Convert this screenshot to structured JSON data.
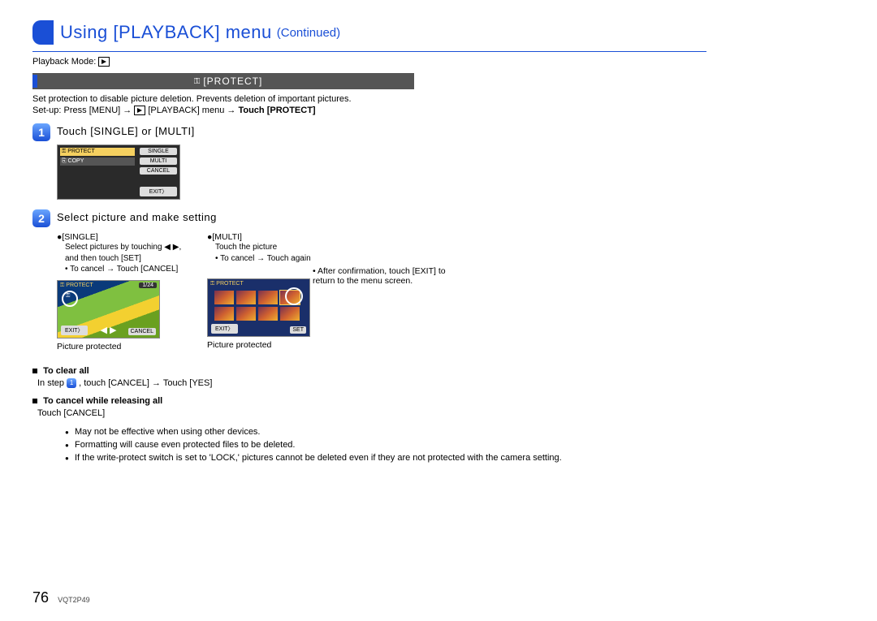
{
  "title": {
    "main": "Using [PLAYBACK] menu",
    "continued": "(Continued)"
  },
  "mode_line": {
    "label": "Playback Mode:"
  },
  "section_bar": {
    "key_glyph": "⚿",
    "text": "[PROTECT]"
  },
  "intro": "Set protection to disable picture deletion. Prevents deletion of important pictures.",
  "setup": {
    "prefix": "Set-up: Press [MENU] → ",
    "mid": " [PLAYBACK] menu → ",
    "suffix": "Touch [PROTECT]"
  },
  "step1": {
    "num": "1",
    "title": "Touch [SINGLE] or [MULTI]",
    "lcd": {
      "row_protect": "⚿ PROTECT",
      "row_copy": "⎘ COPY",
      "btn_single": "SINGLE",
      "btn_multi": "MULTI",
      "btn_cancel": "CANCEL",
      "btn_exit": "EXIT〉"
    }
  },
  "step2": {
    "num": "2",
    "title": "Select picture and make setting",
    "single": {
      "label": "●[SINGLE]",
      "line1": "Select pictures by touching ◀ ▶,",
      "line2": "and then touch [SET]",
      "line3": "• To cancel → Touch [CANCEL]",
      "lcd": {
        "top": "⚿ PROTECT",
        "idx": "1/24",
        "exit": "EXIT〉",
        "cancel": "CANCEL",
        "arrows": "◀  ▶"
      },
      "caption": "Picture protected"
    },
    "multi": {
      "label": "●[MULTI]",
      "line1": "Touch the picture",
      "line2": "• To cancel → Touch again",
      "lcd": {
        "top": "⚿ PROTECT",
        "exit": "EXIT〉",
        "set": "SET"
      },
      "caption": "Picture protected"
    },
    "side_note": "• After confirmation, touch [EXIT] to return to the menu screen."
  },
  "clear": {
    "heading": "To clear all",
    "text_pre": "In step ",
    "mini": "1",
    "text_post": ", touch [CANCEL] → Touch [YES]"
  },
  "cancel_rel": {
    "heading": "To cancel while releasing all",
    "text": "Touch [CANCEL]"
  },
  "notes": [
    "May not be effective when using other devices.",
    "Formatting will cause even protected files to be deleted.",
    "If the write-protect switch is set to 'LOCK,' pictures cannot be deleted even if they are not protected with the camera setting."
  ],
  "footer": {
    "page": "76",
    "docid": "VQT2P49"
  }
}
